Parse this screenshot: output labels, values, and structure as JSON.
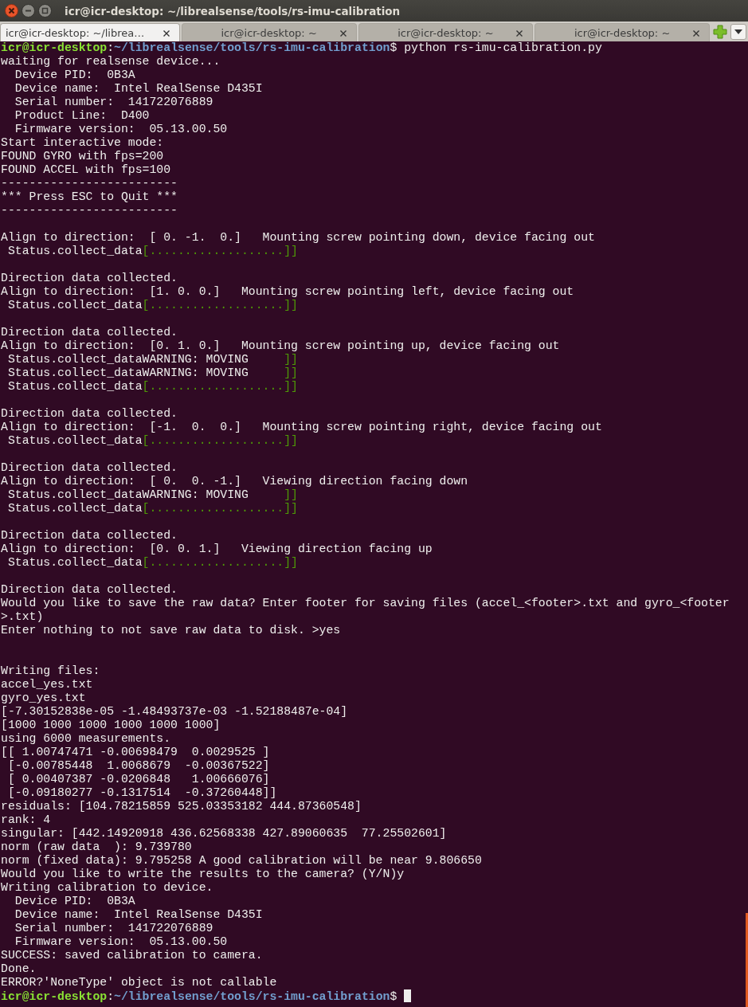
{
  "window": {
    "title": "icr@icr-desktop: ~/librealsense/tools/rs-imu-calibration"
  },
  "tabs": [
    {
      "label": "icr@icr-desktop: ~/librea…",
      "selected": true
    },
    {
      "label": "icr@icr-desktop: ~",
      "selected": false
    },
    {
      "label": "icr@icr-desktop: ~",
      "selected": false
    },
    {
      "label": "icr@icr-desktop: ~",
      "selected": false
    }
  ],
  "terminal": {
    "lines": [
      {
        "kind": "output",
        "spans": [
          {
            "kind": "user",
            "text": "icr@icr-desktop"
          },
          {
            "kind": "plain",
            "text": ":"
          },
          {
            "kind": "path",
            "text": "~/librealsense/tools/rs-imu-calibration"
          },
          {
            "kind": "plain",
            "text": "$ python rs-imu-calibration.py"
          }
        ]
      },
      {
        "kind": "output",
        "spans": [
          {
            "kind": "plain",
            "text": "waiting for realsense device..."
          }
        ]
      },
      {
        "kind": "output",
        "spans": [
          {
            "kind": "plain",
            "text": "  Device PID:  0B3A"
          }
        ]
      },
      {
        "kind": "output",
        "spans": [
          {
            "kind": "plain",
            "text": "  Device name:  Intel RealSense D435I"
          }
        ]
      },
      {
        "kind": "output",
        "spans": [
          {
            "kind": "plain",
            "text": "  Serial number:  141722076889"
          }
        ]
      },
      {
        "kind": "output",
        "spans": [
          {
            "kind": "plain",
            "text": "  Product Line:  D400"
          }
        ]
      },
      {
        "kind": "output",
        "spans": [
          {
            "kind": "plain",
            "text": "  Firmware version:  05.13.00.50"
          }
        ]
      },
      {
        "kind": "output",
        "spans": [
          {
            "kind": "plain",
            "text": "Start interactive mode:"
          }
        ]
      },
      {
        "kind": "output",
        "spans": [
          {
            "kind": "plain",
            "text": "FOUND GYRO with fps=200"
          }
        ]
      },
      {
        "kind": "output",
        "spans": [
          {
            "kind": "plain",
            "text": "FOUND ACCEL with fps=100"
          }
        ]
      },
      {
        "kind": "output",
        "spans": [
          {
            "kind": "plain",
            "text": "-------------------------"
          }
        ]
      },
      {
        "kind": "output",
        "spans": [
          {
            "kind": "plain",
            "text": "*** Press ESC to Quit ***"
          }
        ]
      },
      {
        "kind": "output",
        "spans": [
          {
            "kind": "plain",
            "text": "-------------------------"
          }
        ]
      },
      {
        "kind": "blank"
      },
      {
        "kind": "output",
        "spans": [
          {
            "kind": "plain",
            "text": "Align to direction:  [ 0. -1.  0.]   Mounting screw pointing down, device facing out"
          }
        ]
      },
      {
        "kind": "output",
        "spans": [
          {
            "kind": "plain",
            "text": " Status.collect_data"
          },
          {
            "kind": "green",
            "text": "[...................]]"
          }
        ]
      },
      {
        "kind": "blank"
      },
      {
        "kind": "output",
        "spans": [
          {
            "kind": "plain",
            "text": "Direction data collected."
          }
        ]
      },
      {
        "kind": "output",
        "spans": [
          {
            "kind": "plain",
            "text": "Align to direction:  [1. 0. 0.]   Mounting screw pointing left, device facing out"
          }
        ]
      },
      {
        "kind": "output",
        "spans": [
          {
            "kind": "plain",
            "text": " Status.collect_data"
          },
          {
            "kind": "green",
            "text": "[...................]]"
          }
        ]
      },
      {
        "kind": "blank"
      },
      {
        "kind": "output",
        "spans": [
          {
            "kind": "plain",
            "text": "Direction data collected."
          }
        ]
      },
      {
        "kind": "output",
        "spans": [
          {
            "kind": "plain",
            "text": "Align to direction:  [0. 1. 0.]   Mounting screw pointing up, device facing out"
          }
        ]
      },
      {
        "kind": "output",
        "spans": [
          {
            "kind": "plain",
            "text": " Status.collect_dataWARNING: MOVING     "
          },
          {
            "kind": "green",
            "text": "]]"
          }
        ]
      },
      {
        "kind": "output",
        "spans": [
          {
            "kind": "plain",
            "text": " Status.collect_dataWARNING: MOVING     "
          },
          {
            "kind": "green",
            "text": "]]"
          }
        ]
      },
      {
        "kind": "output",
        "spans": [
          {
            "kind": "plain",
            "text": " Status.collect_data"
          },
          {
            "kind": "green",
            "text": "[...................]]"
          }
        ]
      },
      {
        "kind": "blank"
      },
      {
        "kind": "output",
        "spans": [
          {
            "kind": "plain",
            "text": "Direction data collected."
          }
        ]
      },
      {
        "kind": "output",
        "spans": [
          {
            "kind": "plain",
            "text": "Align to direction:  [-1.  0.  0.]   Mounting screw pointing right, device facing out"
          }
        ]
      },
      {
        "kind": "output",
        "spans": [
          {
            "kind": "plain",
            "text": " Status.collect_data"
          },
          {
            "kind": "green",
            "text": "[...................]]"
          }
        ]
      },
      {
        "kind": "blank"
      },
      {
        "kind": "output",
        "spans": [
          {
            "kind": "plain",
            "text": "Direction data collected."
          }
        ]
      },
      {
        "kind": "output",
        "spans": [
          {
            "kind": "plain",
            "text": "Align to direction:  [ 0.  0. -1.]   Viewing direction facing down"
          }
        ]
      },
      {
        "kind": "output",
        "spans": [
          {
            "kind": "plain",
            "text": " Status.collect_dataWARNING: MOVING     "
          },
          {
            "kind": "green",
            "text": "]]"
          }
        ]
      },
      {
        "kind": "output",
        "spans": [
          {
            "kind": "plain",
            "text": " Status.collect_data"
          },
          {
            "kind": "green",
            "text": "[...................]]"
          }
        ]
      },
      {
        "kind": "blank"
      },
      {
        "kind": "output",
        "spans": [
          {
            "kind": "plain",
            "text": "Direction data collected."
          }
        ]
      },
      {
        "kind": "output",
        "spans": [
          {
            "kind": "plain",
            "text": "Align to direction:  [0. 0. 1.]   Viewing direction facing up"
          }
        ]
      },
      {
        "kind": "output",
        "spans": [
          {
            "kind": "plain",
            "text": " Status.collect_data"
          },
          {
            "kind": "green",
            "text": "[...................]]"
          }
        ]
      },
      {
        "kind": "blank"
      },
      {
        "kind": "output",
        "spans": [
          {
            "kind": "plain",
            "text": "Direction data collected."
          }
        ]
      },
      {
        "kind": "output",
        "spans": [
          {
            "kind": "plain",
            "text": "Would you like to save the raw data? Enter footer for saving files (accel_<footer>.txt and gyro_<footer"
          }
        ]
      },
      {
        "kind": "output",
        "spans": [
          {
            "kind": "plain",
            "text": ">.txt)"
          }
        ]
      },
      {
        "kind": "output",
        "spans": [
          {
            "kind": "plain",
            "text": "Enter nothing to not save raw data to disk. >yes"
          }
        ]
      },
      {
        "kind": "blank"
      },
      {
        "kind": "blank"
      },
      {
        "kind": "output",
        "spans": [
          {
            "kind": "plain",
            "text": "Writing files:"
          }
        ]
      },
      {
        "kind": "output",
        "spans": [
          {
            "kind": "plain",
            "text": "accel_yes.txt"
          }
        ]
      },
      {
        "kind": "output",
        "spans": [
          {
            "kind": "plain",
            "text": "gyro_yes.txt"
          }
        ]
      },
      {
        "kind": "output",
        "spans": [
          {
            "kind": "plain",
            "text": "[-7.30152838e-05 -1.48493737e-03 -1.52188487e-04]"
          }
        ]
      },
      {
        "kind": "output",
        "spans": [
          {
            "kind": "plain",
            "text": "[1000 1000 1000 1000 1000 1000]"
          }
        ]
      },
      {
        "kind": "output",
        "spans": [
          {
            "kind": "plain",
            "text": "using 6000 measurements."
          }
        ]
      },
      {
        "kind": "output",
        "spans": [
          {
            "kind": "plain",
            "text": "[[ 1.00747471 -0.00698479  0.0029525 ]"
          }
        ]
      },
      {
        "kind": "output",
        "spans": [
          {
            "kind": "plain",
            "text": " [-0.00785448  1.0068679  -0.00367522]"
          }
        ]
      },
      {
        "kind": "output",
        "spans": [
          {
            "kind": "plain",
            "text": " [ 0.00407387 -0.0206848   1.00666076]"
          }
        ]
      },
      {
        "kind": "output",
        "spans": [
          {
            "kind": "plain",
            "text": " [-0.09180277 -0.1317514  -0.37260448]]"
          }
        ]
      },
      {
        "kind": "output",
        "spans": [
          {
            "kind": "plain",
            "text": "residuals: [104.78215859 525.03353182 444.87360548]"
          }
        ]
      },
      {
        "kind": "output",
        "spans": [
          {
            "kind": "plain",
            "text": "rank: 4"
          }
        ]
      },
      {
        "kind": "output",
        "spans": [
          {
            "kind": "plain",
            "text": "singular: [442.14920918 436.62568338 427.89060635  77.25502601]"
          }
        ]
      },
      {
        "kind": "output",
        "spans": [
          {
            "kind": "plain",
            "text": "norm (raw data  ): 9.739780"
          }
        ]
      },
      {
        "kind": "output",
        "spans": [
          {
            "kind": "plain",
            "text": "norm (fixed data): 9.795258 A good calibration will be near 9.806650"
          }
        ]
      },
      {
        "kind": "output",
        "spans": [
          {
            "kind": "plain",
            "text": "Would you like to write the results to the camera? (Y/N)y"
          }
        ]
      },
      {
        "kind": "output",
        "spans": [
          {
            "kind": "plain",
            "text": "Writing calibration to device."
          }
        ]
      },
      {
        "kind": "output",
        "spans": [
          {
            "kind": "plain",
            "text": "  Device PID:  0B3A"
          }
        ]
      },
      {
        "kind": "output",
        "spans": [
          {
            "kind": "plain",
            "text": "  Device name:  Intel RealSense D435I"
          }
        ]
      },
      {
        "kind": "output",
        "spans": [
          {
            "kind": "plain",
            "text": "  Serial number:  141722076889"
          }
        ]
      },
      {
        "kind": "output",
        "spans": [
          {
            "kind": "plain",
            "text": "  Firmware version:  05.13.00.50"
          }
        ]
      },
      {
        "kind": "output",
        "spans": [
          {
            "kind": "plain",
            "text": "SUCCESS: saved calibration to camera."
          }
        ]
      },
      {
        "kind": "output",
        "spans": [
          {
            "kind": "plain",
            "text": "Done."
          }
        ]
      },
      {
        "kind": "output",
        "spans": [
          {
            "kind": "plain",
            "text": "ERROR?'NoneType' object is not callable"
          }
        ]
      },
      {
        "kind": "prompt",
        "spans": [
          {
            "kind": "user",
            "text": "icr@icr-desktop"
          },
          {
            "kind": "plain",
            "text": ":"
          },
          {
            "kind": "path",
            "text": "~/librealsense/tools/rs-imu-calibration"
          },
          {
            "kind": "plain",
            "text": "$ "
          }
        ]
      }
    ]
  }
}
